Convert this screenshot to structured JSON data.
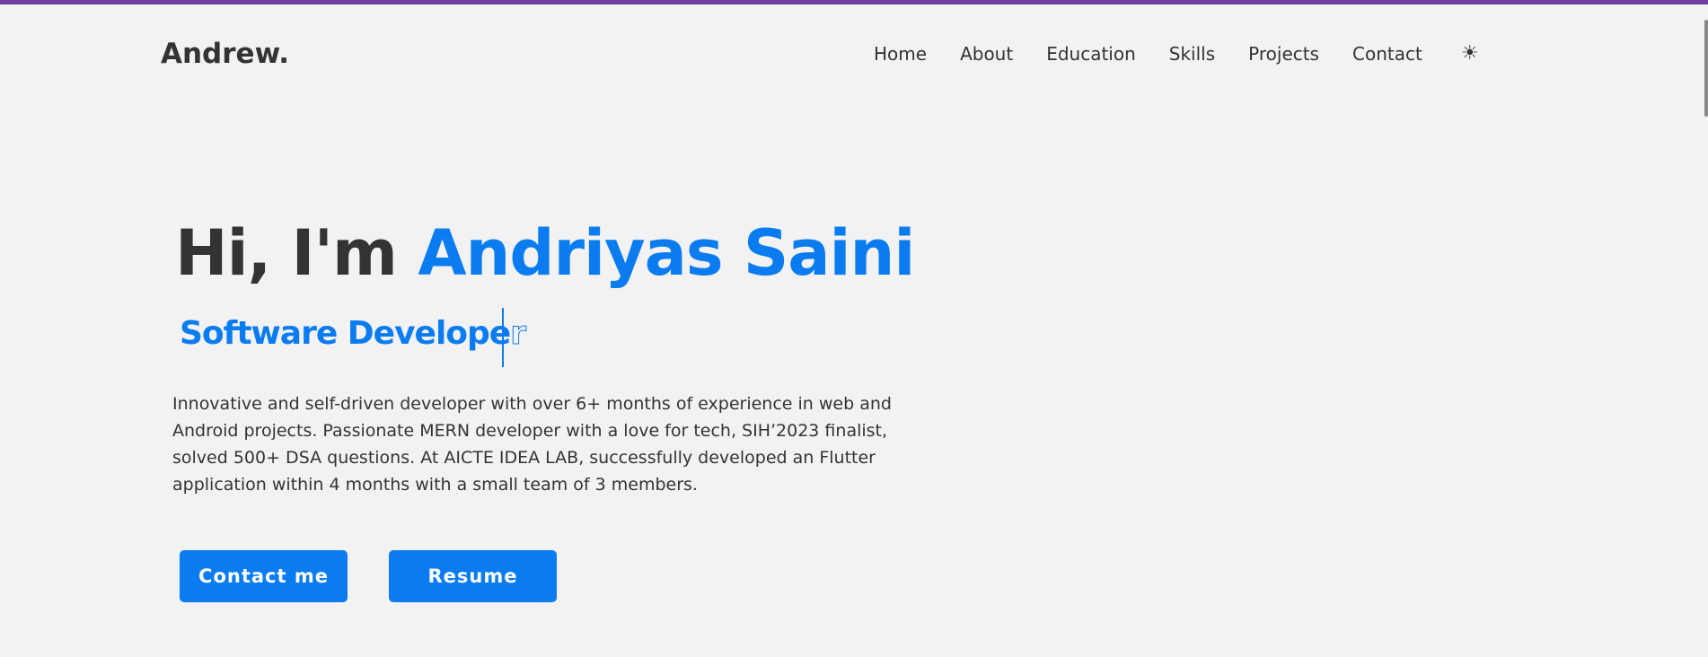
{
  "header": {
    "logo": "Andrew.",
    "nav": [
      "Home",
      "About",
      "Education",
      "Skills",
      "Projects",
      "Contact"
    ],
    "theme_icon": "sun-icon"
  },
  "hero": {
    "greeting": "Hi, I'm ",
    "name": "Andriyas Saini",
    "role_typed": "Software Develope",
    "role_pending": "r",
    "description": "Innovative and self-driven developer with over 6+ months of experience in web and Android projects. Passionate MERN developer with a love for tech, SIH’2023 finalist, solved 500+ DSA questions. At AICTE IDEA LAB, successfully developed an Flutter application within 4 months with a small team of 3 members.",
    "buttons": {
      "contact": "Contact me",
      "resume": "Resume"
    }
  },
  "colors": {
    "accent": "#0b7cf0",
    "top_bar": "#6b3fa0",
    "background": "#f2f2f2",
    "text": "#333333"
  }
}
